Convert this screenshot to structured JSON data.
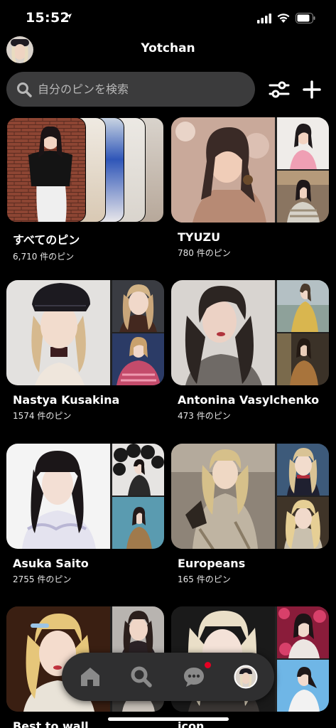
{
  "status_bar": {
    "time": "15:52"
  },
  "header": {
    "title": "Yotchan"
  },
  "search": {
    "placeholder": "自分のピンを検索"
  },
  "boards": [
    {
      "name": "すべてのピン",
      "count": "6,710 件のピン"
    },
    {
      "name": "TYUZU",
      "count": "780 件のピン"
    },
    {
      "name": "Nastya Kusakina",
      "count": "1574 件のピン"
    },
    {
      "name": "Antonina Vasylchenko",
      "count": "473 件のピン"
    },
    {
      "name": "Asuka Saito",
      "count": "2755 件のピン"
    },
    {
      "name": "Europeans",
      "count": "165 件のピン"
    },
    {
      "name": "Best to wall",
      "count": ""
    },
    {
      "name": "icon",
      "count": ""
    }
  ],
  "nav": {
    "items": [
      {
        "icon": "home-icon"
      },
      {
        "icon": "search-icon"
      },
      {
        "icon": "messages-icon",
        "notification": true
      },
      {
        "icon": "profile-avatar"
      }
    ]
  },
  "colors": {
    "background": "#000000",
    "search_bg": "#3b3b3c",
    "nav_bg": "#2f2f30",
    "badge": "#e60023"
  }
}
